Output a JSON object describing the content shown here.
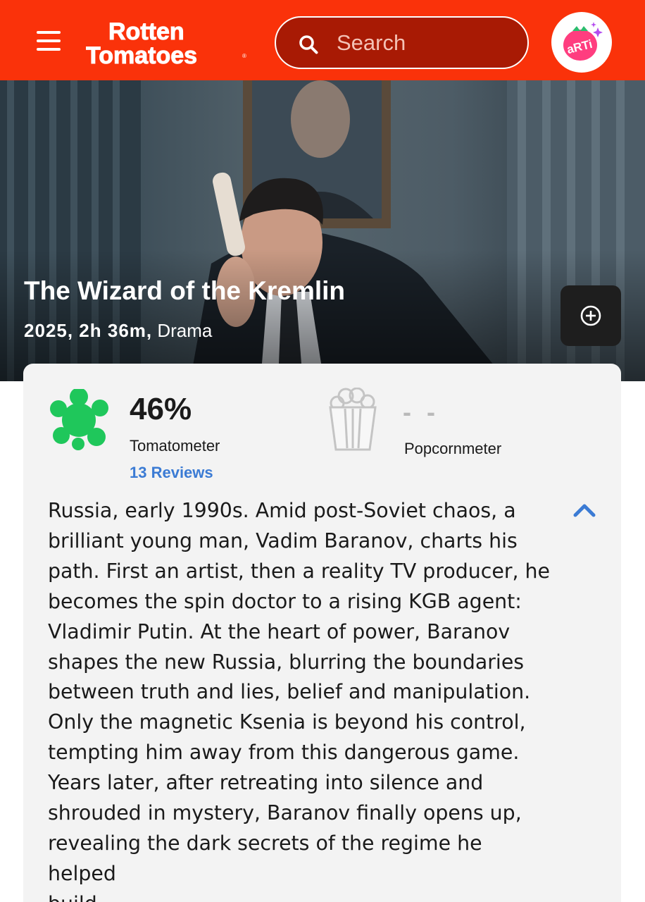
{
  "header": {
    "logo_text": "Rotten Tomatoes",
    "search_placeholder": "Search",
    "avatar_text": "aRTi",
    "brand_color": "#fa320a"
  },
  "movie": {
    "title": "The Wizard of the Kremlin",
    "year_runtime": "2025, 2h 36m,",
    "genre": "Drama"
  },
  "scores": {
    "tomatometer_value": "46%",
    "tomatometer_label": "Tomatometer",
    "reviews_link": "13 Reviews",
    "popcornmeter_value": "- -",
    "popcornmeter_label": "Popcornmeter"
  },
  "synopsis_lines": [
    "Russia, early 1990s. Amid post-Soviet chaos, a",
    "brilliant young man, Vadim Baranov, charts his",
    "path. First an artist, then a reality TV producer, he",
    "becomes the spin doctor to a rising KGB agent:",
    "Vladimir Putin. At the heart of power, Baranov",
    "shapes the new Russia, blurring the boundaries",
    "between truth and lies, belief and manipulation.",
    "Only the magnetic Ksenia is beyond his control,",
    "tempting him away from this dangerous game.",
    "Years later, after retreating into silence and",
    "shrouded in mystery, Baranov finally opens up,",
    "revealing the dark secrets of the regime he helped",
    "build."
  ],
  "icons": {
    "menu": "hamburger-menu-icon",
    "search": "search-icon",
    "add": "plus-circle-icon",
    "tomatometer": "green-splat-icon",
    "popcornmeter": "empty-popcorn-icon",
    "collapse": "chevron-up-icon"
  }
}
